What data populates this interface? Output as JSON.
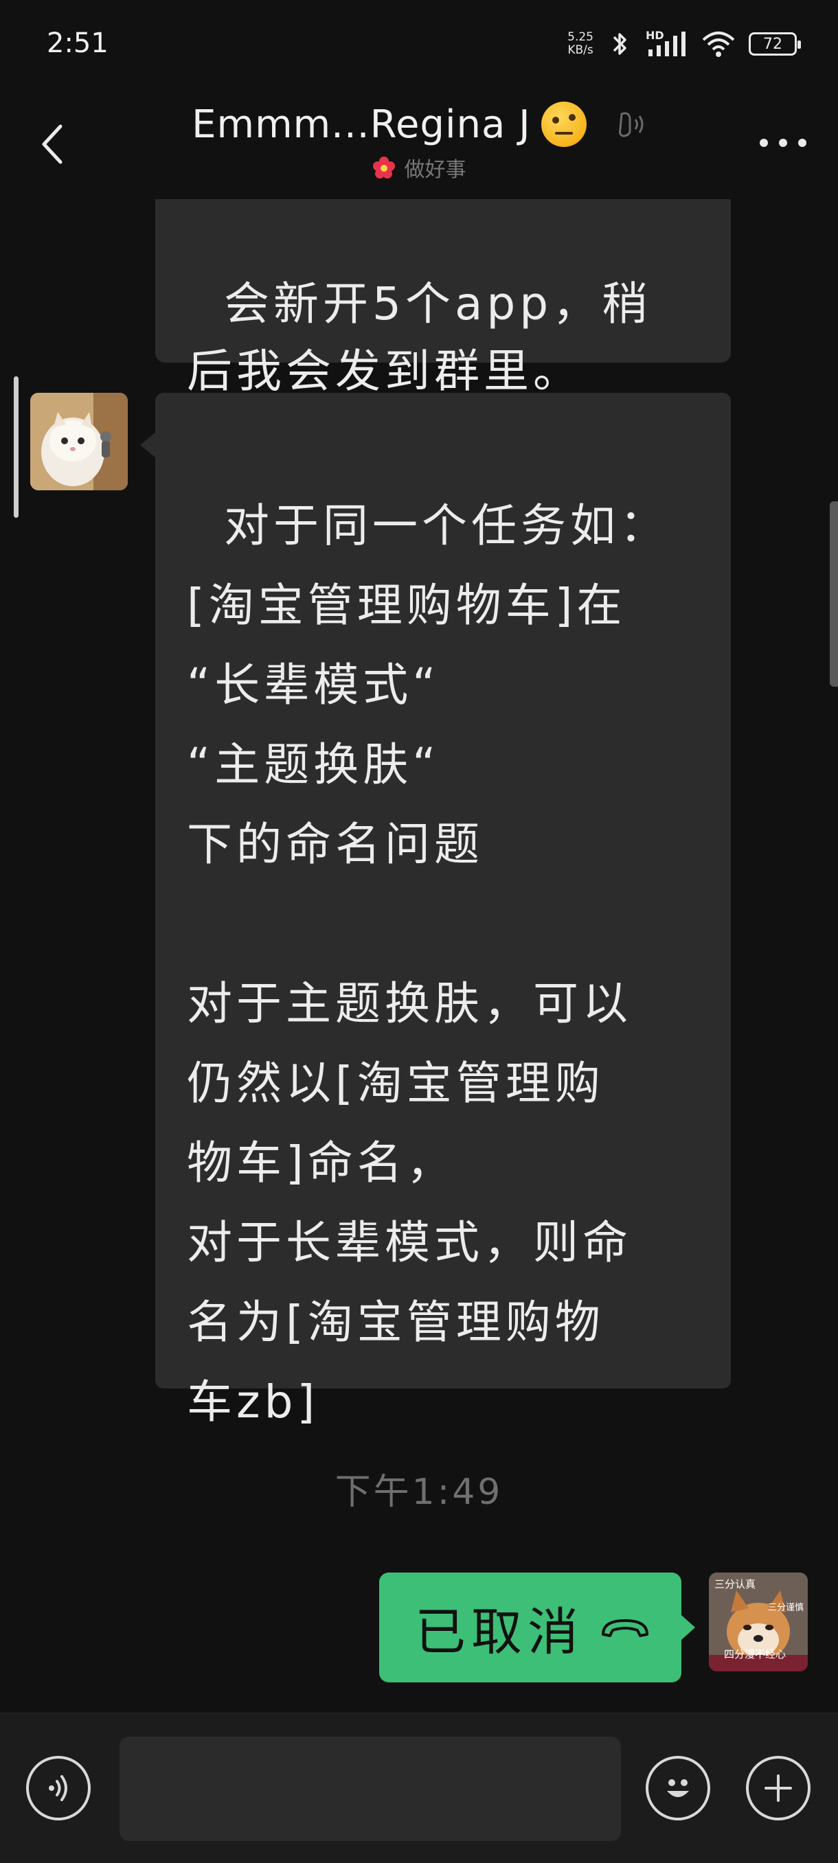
{
  "status_bar": {
    "time": "2:51",
    "net_speed_value": "5.25",
    "net_speed_unit": "KB/s",
    "network_label": "HD",
    "battery": "72"
  },
  "header": {
    "title": "Emmm...Regina J",
    "subtitle": "做好事"
  },
  "messages": {
    "top_partial": "会新开5个app，稍\n后我会发到群里。",
    "main": "对于同一个任务如：\n[淘宝管理购物车]在\n“长辈模式“\n“主题换肤“\n下的命名问题\n\n对于主题换肤，可以\n仍然以[淘宝管理购\n物车]命名，\n对于长辈模式，则命\n名为[淘宝管理购物\n车zb]",
    "timestamp": "下午1:49",
    "outgoing_call": "已取消",
    "dog_sticker": {
      "top_left": "三分认真",
      "top_right": "三分谨慎",
      "bottom": "四分漫不经心"
    }
  },
  "colors": {
    "background": "#111111",
    "incoming_bubble": "#2c2c2c",
    "outgoing_bubble": "#3dbf77",
    "input_bar": "#1c1c1c"
  },
  "icons": {
    "back": "chevron-left-icon",
    "more": "more-dots-icon",
    "earpiece": "earpiece-mode-icon",
    "voice": "voice-input-icon",
    "emoji": "emoji-icon",
    "plus": "plus-icon"
  }
}
